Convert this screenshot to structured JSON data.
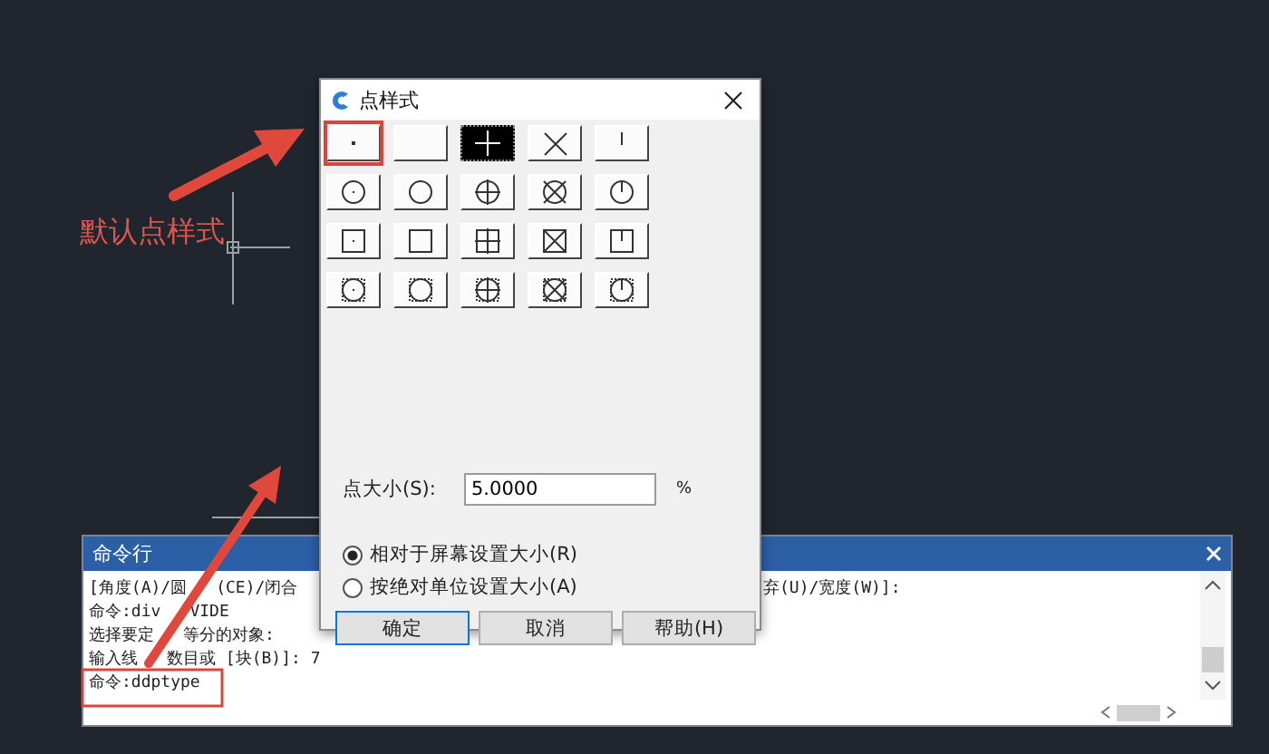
{
  "annotation": {
    "label": "默认点样式"
  },
  "dialog": {
    "title": "点样式",
    "styles": [
      {
        "kind": "dot",
        "selected": false
      },
      {
        "kind": "blank",
        "selected": false
      },
      {
        "kind": "plus",
        "selected": true
      },
      {
        "kind": "cross",
        "selected": false
      },
      {
        "kind": "tick",
        "selected": false
      },
      {
        "kind": "circle-dot",
        "selected": false
      },
      {
        "kind": "circle",
        "selected": false
      },
      {
        "kind": "circle-plus",
        "selected": false
      },
      {
        "kind": "circle-cross",
        "selected": false
      },
      {
        "kind": "circle-tick",
        "selected": false
      },
      {
        "kind": "square-dot",
        "selected": false
      },
      {
        "kind": "square",
        "selected": false
      },
      {
        "kind": "square-plus",
        "selected": false
      },
      {
        "kind": "square-cross",
        "selected": false
      },
      {
        "kind": "square-tick",
        "selected": false
      },
      {
        "kind": "both-dot",
        "selected": false
      },
      {
        "kind": "both",
        "selected": false
      },
      {
        "kind": "both-plus",
        "selected": false
      },
      {
        "kind": "both-cross",
        "selected": false
      },
      {
        "kind": "both-tick",
        "selected": false
      }
    ],
    "size_label": "点大小(S):",
    "size_value": "5.0000",
    "size_unit": "%",
    "options": [
      {
        "label": "相对于屏幕设置大小(R)",
        "selected": true
      },
      {
        "label": "按绝对单位设置大小(A)",
        "selected": false
      }
    ],
    "buttons": [
      "确定",
      "取消",
      "帮助(H)"
    ]
  },
  "command_window": {
    "title": "命令行",
    "lines": [
      {
        "segments": [
          "[角度(A)/圆",
          "(CE)/闭合"
        ],
        "tail": "弃(U)/宽度(W)]:"
      },
      {
        "segments": [
          "命令:div",
          "VIDE"
        ]
      },
      {
        "segments": [
          "选择要定",
          "等分的对象:"
        ]
      },
      {
        "segments": [
          "输入线",
          "数目或 [块(B)]: 7"
        ]
      },
      {
        "segments": [
          "命令:ddptype"
        ]
      }
    ]
  }
}
